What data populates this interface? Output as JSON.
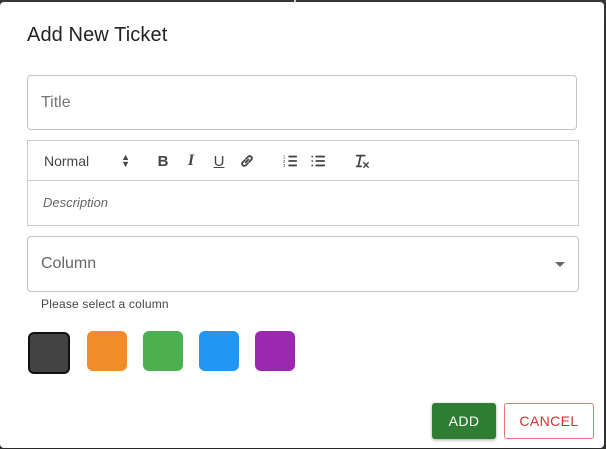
{
  "dialog": {
    "title": "Add New Ticket"
  },
  "form": {
    "title_placeholder": "Title",
    "editor": {
      "header_select_value": "Normal",
      "bold_label": "B",
      "italic_label": "I",
      "underline_label": "U",
      "description_placeholder": "Description",
      "toolbar_icons": [
        "link-icon",
        "ordered-list-icon",
        "bullet-list-icon",
        "clear-format-icon"
      ]
    },
    "column_label": "Column",
    "column_helper": "Please select a column",
    "colors": [
      {
        "name": "dark-gray",
        "hex": "#424242",
        "selected": true
      },
      {
        "name": "orange",
        "hex": "#f28c28",
        "selected": false
      },
      {
        "name": "green",
        "hex": "#4caf50",
        "selected": false
      },
      {
        "name": "blue",
        "hex": "#2196f3",
        "selected": false
      },
      {
        "name": "purple",
        "hex": "#9c27b0",
        "selected": false
      }
    ]
  },
  "actions": {
    "add_label": "ADD",
    "cancel_label": "CANCEL"
  },
  "theme": {
    "primary_green": "#2e7d32",
    "cancel_red": "#d32f2f"
  }
}
